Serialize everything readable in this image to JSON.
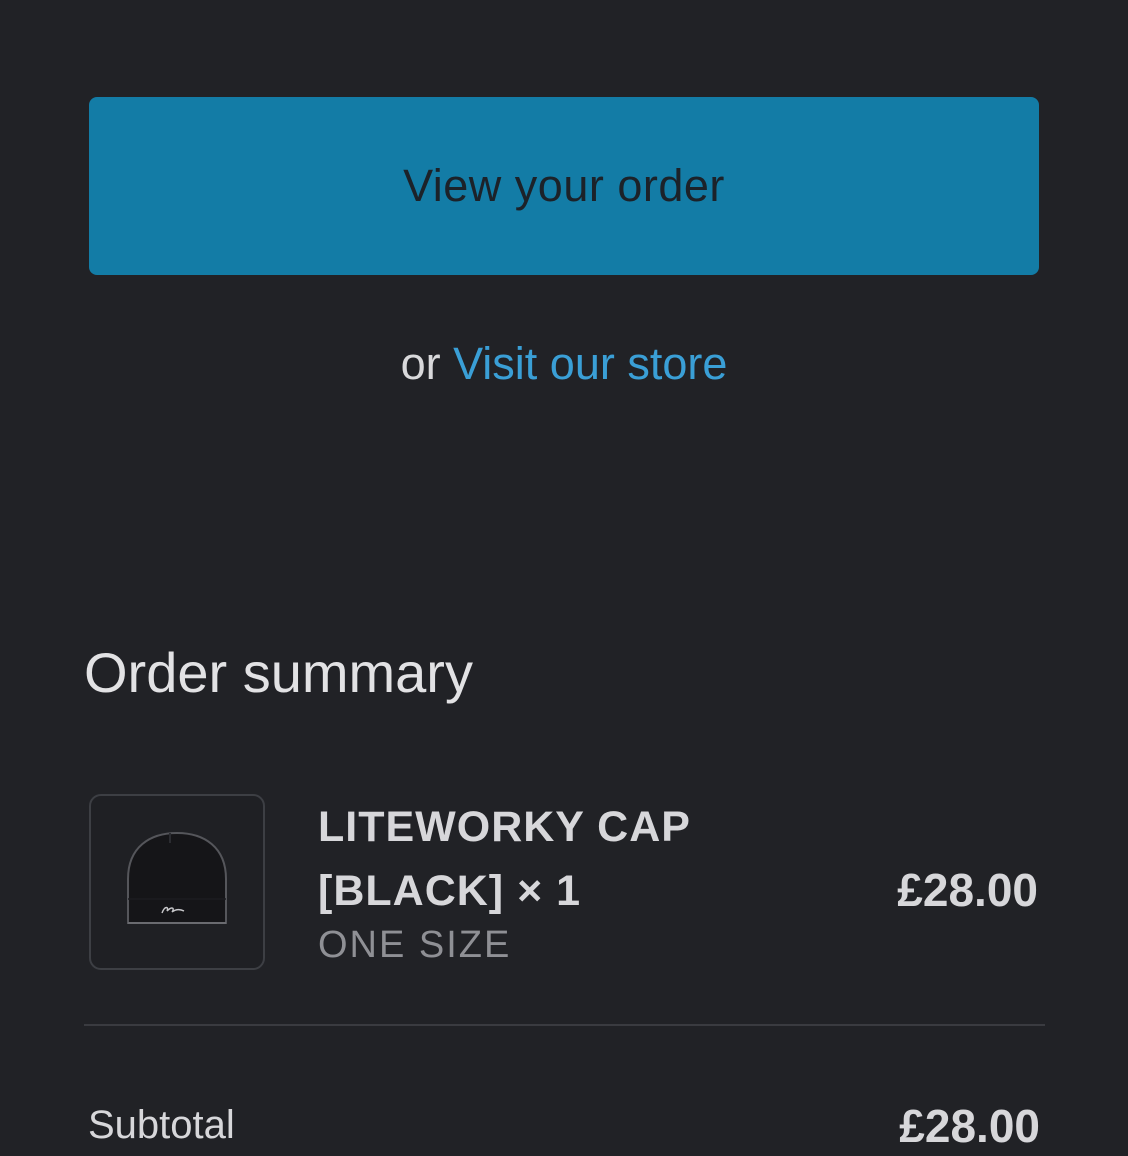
{
  "actions": {
    "view_order_label": "View your order",
    "or_text": "or",
    "visit_store_label": "Visit our store"
  },
  "order_summary": {
    "title": "Order summary",
    "items": [
      {
        "name": "LITEWORKY CAP [BLACK] × 1",
        "variant": "ONE SIZE",
        "price": "£28.00",
        "thumbnail_icon": "beanie-icon"
      }
    ],
    "subtotal_label": "Subtotal",
    "subtotal_value": "£28.00"
  },
  "colors": {
    "background": "#212226",
    "primary_button": "#137ca6",
    "link": "#3a9fd6"
  }
}
